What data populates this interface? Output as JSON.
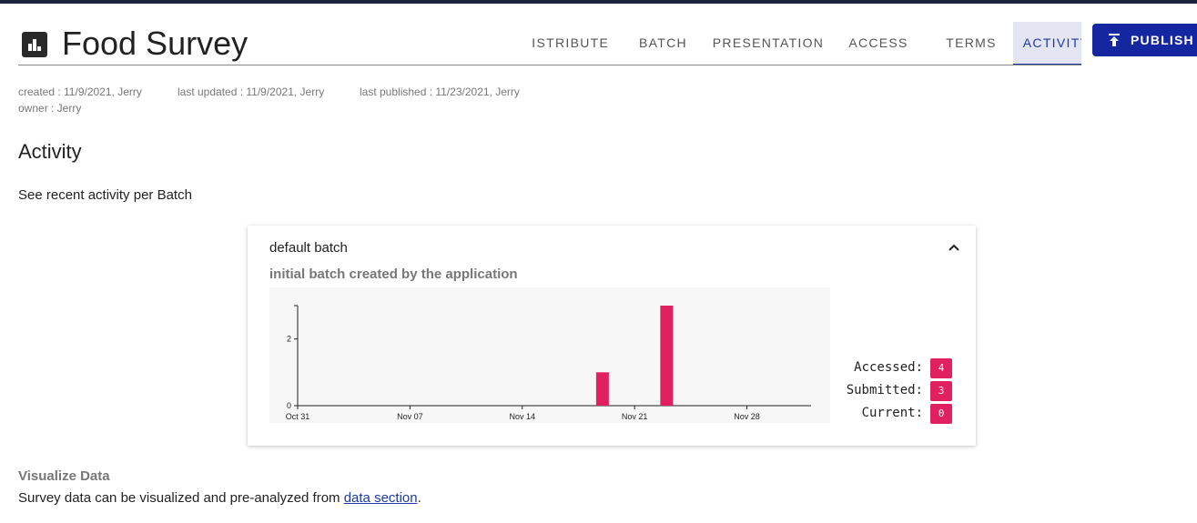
{
  "app": {
    "title": "Food Survey",
    "icon": "bar-chart-icon"
  },
  "tabs": [
    {
      "label": "DISTRIBUTE",
      "active": false
    },
    {
      "label": "BATCH",
      "active": false
    },
    {
      "label": "PRESENTATION",
      "active": false
    },
    {
      "label": "ACCESS",
      "active": false
    },
    {
      "label": "TERMS",
      "active": false
    },
    {
      "label": "ACTIVITY",
      "active": true
    }
  ],
  "publish": {
    "label": "PUBLISH",
    "icon": "publish-upload-icon"
  },
  "meta": {
    "created": "created : 11/9/2021, Jerry",
    "last_updated": "last updated : 11/9/2021, Jerry",
    "last_published": "last published : 11/23/2021, Jerry",
    "owner": "owner : Jerry"
  },
  "activity": {
    "title": "Activity",
    "description": "See recent activity per Batch"
  },
  "batch": {
    "title": "default batch",
    "subtitle": "initial batch created by the application",
    "collapse_icon": "chevron-up-icon",
    "stats": [
      {
        "label": "Accessed:",
        "value": "4"
      },
      {
        "label": "Submitted:",
        "value": "3"
      },
      {
        "label": "Current:",
        "value": "0"
      }
    ]
  },
  "chart_data": {
    "type": "bar",
    "x": [
      "2021-11-19",
      "2021-11-23"
    ],
    "values": [
      1,
      3
    ],
    "xticks": [
      "Oct 31",
      "Nov 07",
      "Nov 14",
      "Nov 21",
      "Nov 28"
    ],
    "yticks": [
      "0",
      "2"
    ],
    "xlim": [
      "2021-10-31",
      "2021-12-02"
    ],
    "ylim": [
      0,
      3
    ],
    "bar_color": "#e0205f",
    "grid": false,
    "title": "",
    "xlabel": "",
    "ylabel": ""
  },
  "visualize": {
    "title": "Visualize Data",
    "text_before": "Survey data can be visualized and pre-analyzed from ",
    "link": "data section",
    "text_after": "."
  },
  "colors": {
    "accent": "#1426a0",
    "active_tab_bg": "#e3e5f3",
    "badge": "#e0205f"
  }
}
